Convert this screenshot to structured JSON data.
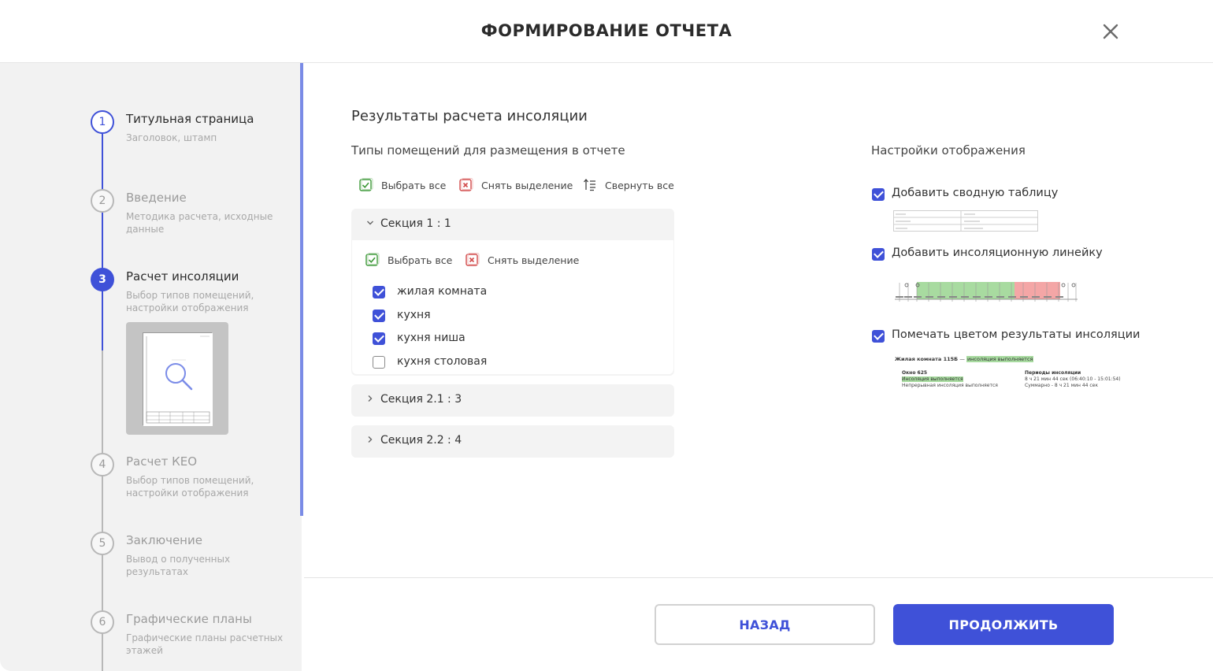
{
  "header": {
    "title": "ФОРМИРОВАНИЕ ОТЧЕТА",
    "close_icon": "close-icon"
  },
  "steps": [
    {
      "num": "1",
      "title": "Титульная страница",
      "subtitle": "Заголовок, штамп",
      "state": "done"
    },
    {
      "num": "2",
      "title": "Введение",
      "subtitle": "Методика расчета, исходные данные",
      "state": "pending"
    },
    {
      "num": "3",
      "title": "Расчет инсоляции",
      "subtitle": "Выбор типов помещений, настройки отображения",
      "state": "active"
    },
    {
      "num": "4",
      "title": "Расчет КЕО",
      "subtitle": "Выбор типов помещений, настройки отображения",
      "state": "pending"
    },
    {
      "num": "5",
      "title": "Заключение",
      "subtitle": "Вывод о полученных результатах",
      "state": "pending"
    },
    {
      "num": "6",
      "title": "Графические планы",
      "subtitle": "Графические планы расчетных этажей",
      "state": "pending"
    }
  ],
  "main": {
    "title": "Результаты расчета инсоляции",
    "room_types_title": "Типы помещений для размещения в отчете",
    "toolbar": {
      "select_all": "Выбрать все",
      "deselect": "Снять выделение",
      "collapse_all": "Свернуть все"
    },
    "sections": [
      {
        "label": "Секция 1 : 1",
        "expanded": true,
        "select_all": "Выбрать все",
        "deselect": "Снять выделение",
        "items": [
          {
            "label": "жилая комната",
            "checked": true
          },
          {
            "label": "кухня",
            "checked": true
          },
          {
            "label": "кухня ниша",
            "checked": true
          },
          {
            "label": "кухня столовая",
            "checked": false
          }
        ]
      },
      {
        "label": "Секция 2.1 : 3",
        "expanded": false
      },
      {
        "label": "Секция 2.2 : 4",
        "expanded": false
      }
    ]
  },
  "settings": {
    "title": "Настройки отображения",
    "options": [
      {
        "label": "Добавить сводную таблицу",
        "checked": true
      },
      {
        "label": "Добавить инсоляционную линейку",
        "checked": true
      },
      {
        "label": "Помечать цветом результаты инсоляции",
        "checked": true
      }
    ],
    "color_preview": {
      "room_line": "Жилая комната 115Б",
      "room_status": "инсоляция выполняется",
      "window": "Окно 625",
      "window_status": "Инсоляция выполняется",
      "continuous": "Непрерывная инсоляция выполняется",
      "periods_title": "Периоды инсоляции",
      "period_1": "8 ч 21 мин 44 сек (06:40:10 - 15:01:54)",
      "period_sum": "Суммарно - 8 ч 21 мин 44 сек"
    }
  },
  "footer": {
    "back": "НАЗАД",
    "next": "ПРОДОЛЖИТЬ"
  },
  "colors": {
    "accent": "#3f51d8",
    "ok_green": "#a8dba0",
    "fail_red": "#f4a6a6"
  }
}
